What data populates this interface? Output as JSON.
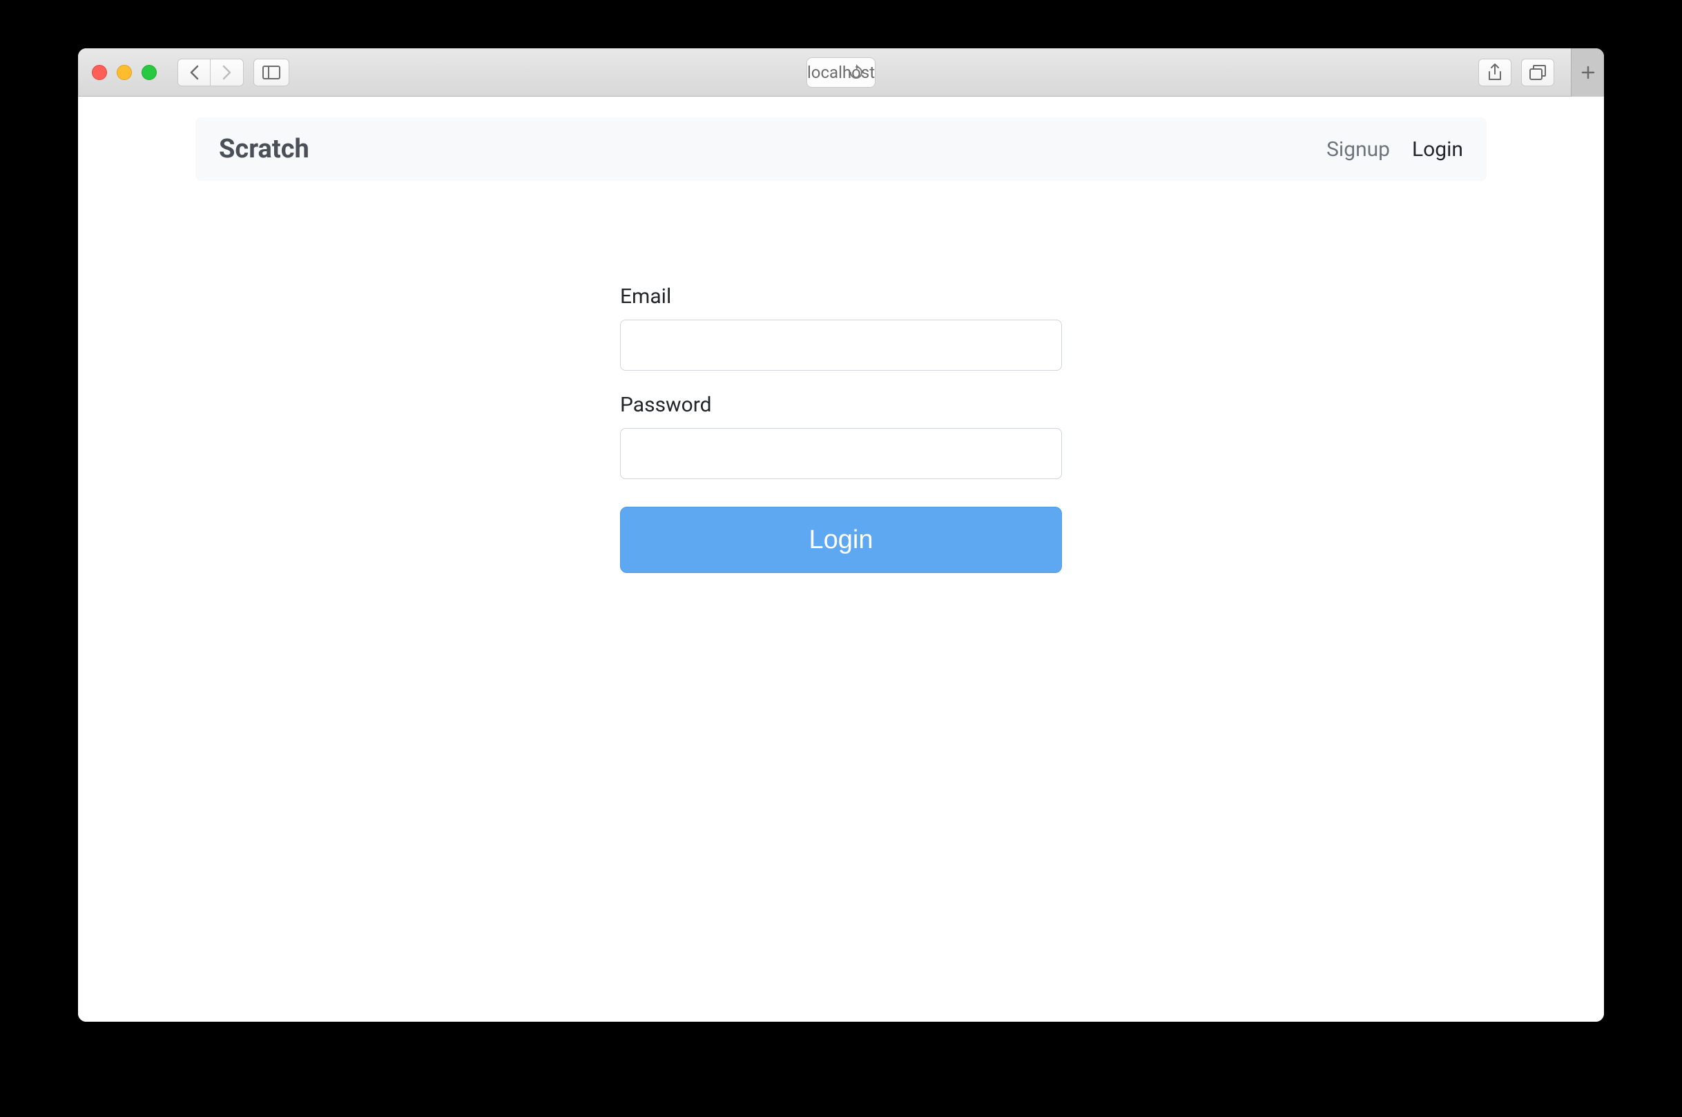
{
  "browser": {
    "address": "localhost"
  },
  "navbar": {
    "brand": "Scratch",
    "links": {
      "signup": "Signup",
      "login": "Login"
    }
  },
  "form": {
    "email_label": "Email",
    "email_value": "",
    "password_label": "Password",
    "password_value": "",
    "submit_label": "Login"
  }
}
